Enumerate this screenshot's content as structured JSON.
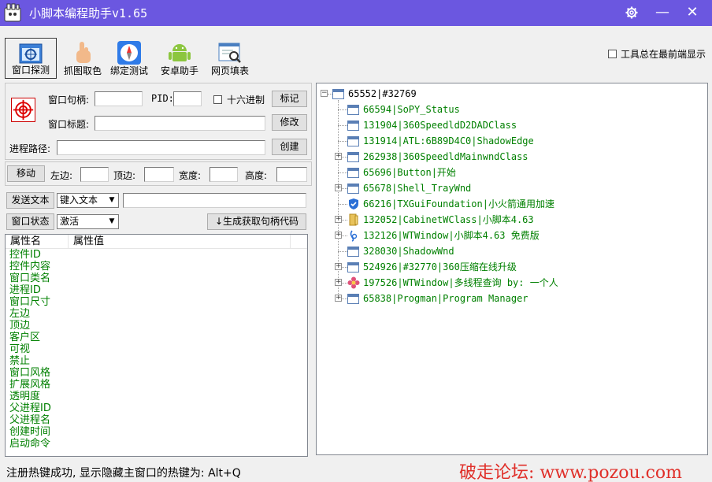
{
  "window": {
    "title": "小脚本编程助手v1.65",
    "settings_icon": "gear-icon",
    "minimize_glyph": "—",
    "close_glyph": "✕"
  },
  "toolbar": {
    "items": [
      {
        "label": "窗口探测",
        "icon": "window-probe-icon",
        "active": true
      },
      {
        "label": "抓图取色",
        "icon": "hand-pointer-icon",
        "active": false
      },
      {
        "label": "绑定测试",
        "icon": "compass-icon",
        "active": false
      },
      {
        "label": "安卓助手",
        "icon": "android-icon",
        "active": false
      },
      {
        "label": "网页填表",
        "icon": "web-form-icon",
        "active": false
      }
    ],
    "always_on_top_label": "工具总在最前端显示"
  },
  "probe": {
    "handle_label": "窗口句柄:",
    "handle_value": "",
    "pid_label": "PID:",
    "pid_value": "",
    "hex_label": "十六进制",
    "mark_button": "标记",
    "title_label": "窗口标题:",
    "title_value": "",
    "modify_button": "修改",
    "path_label": "进程路径:",
    "path_value": "",
    "create_button": "创建"
  },
  "move": {
    "move_button": "移动",
    "left_label": "左边:",
    "top_label": "顶边:",
    "width_label": "宽度:",
    "height_label": "高度:"
  },
  "send": {
    "send_button": "发送文本",
    "mode_value": "键入文本",
    "text_value": ""
  },
  "state": {
    "state_button": "窗口状态",
    "state_value": "激活",
    "gen_code_button": "↓生成获取句柄代码"
  },
  "properties": {
    "columns": [
      "属性名",
      "属性值"
    ],
    "rows": [
      "控件ID",
      "控件内容",
      "窗口类名",
      "进程ID",
      "窗口尺寸",
      "左边",
      "顶边",
      "客户区",
      "可视",
      "禁止",
      "窗口风格",
      "扩展风格",
      "透明度",
      "父进程ID",
      "父进程名",
      "创建时间",
      "启动命令"
    ]
  },
  "tree": {
    "root": "65552|#32769",
    "children": [
      {
        "text": "66594|SoPY_Status",
        "expandable": false,
        "icon": "window-icon"
      },
      {
        "text": "131904|360SpeedldD2DADClass",
        "expandable": false,
        "icon": "window-icon"
      },
      {
        "text": "131914|ATL:6B89D4C0|ShadowEdge",
        "expandable": false,
        "icon": "window-icon"
      },
      {
        "text": "262938|360SpeedldMainwndClass",
        "expandable": true,
        "icon": "window-icon"
      },
      {
        "text": "65696|Button|开始",
        "expandable": false,
        "icon": "window-icon"
      },
      {
        "text": "65678|Shell_TrayWnd",
        "expandable": true,
        "icon": "window-icon"
      },
      {
        "text": "66216|TXGuiFoundation|小火箭通用加速",
        "expandable": false,
        "icon": "shield-icon"
      },
      {
        "text": "132052|CabinetWClass|小脚本4.63",
        "expandable": true,
        "icon": "folder-icon"
      },
      {
        "text": "132126|WTWindow|小脚本4.63 免费版",
        "expandable": true,
        "icon": "script-icon"
      },
      {
        "text": "328030|ShadowWnd",
        "expandable": false,
        "icon": "window-icon"
      },
      {
        "text": "524926|#32770|360压缩在线升级",
        "expandable": true,
        "icon": "window-icon"
      },
      {
        "text": "197526|WTWindow|多线程查询 by: 一个人",
        "expandable": true,
        "icon": "flower-icon"
      },
      {
        "text": "65838|Progman|Program Manager",
        "expandable": true,
        "icon": "window-icon"
      }
    ]
  },
  "status": {
    "message": "注册热键成功, 显示隐藏主窗口的热键为: Alt+Q",
    "watermark": "破走论坛: www.pozou.com"
  },
  "colors": {
    "titlebar": "#6b57e0",
    "tree_child_text": "#008000",
    "property_text": "#008000",
    "watermark": "#e0302a"
  }
}
